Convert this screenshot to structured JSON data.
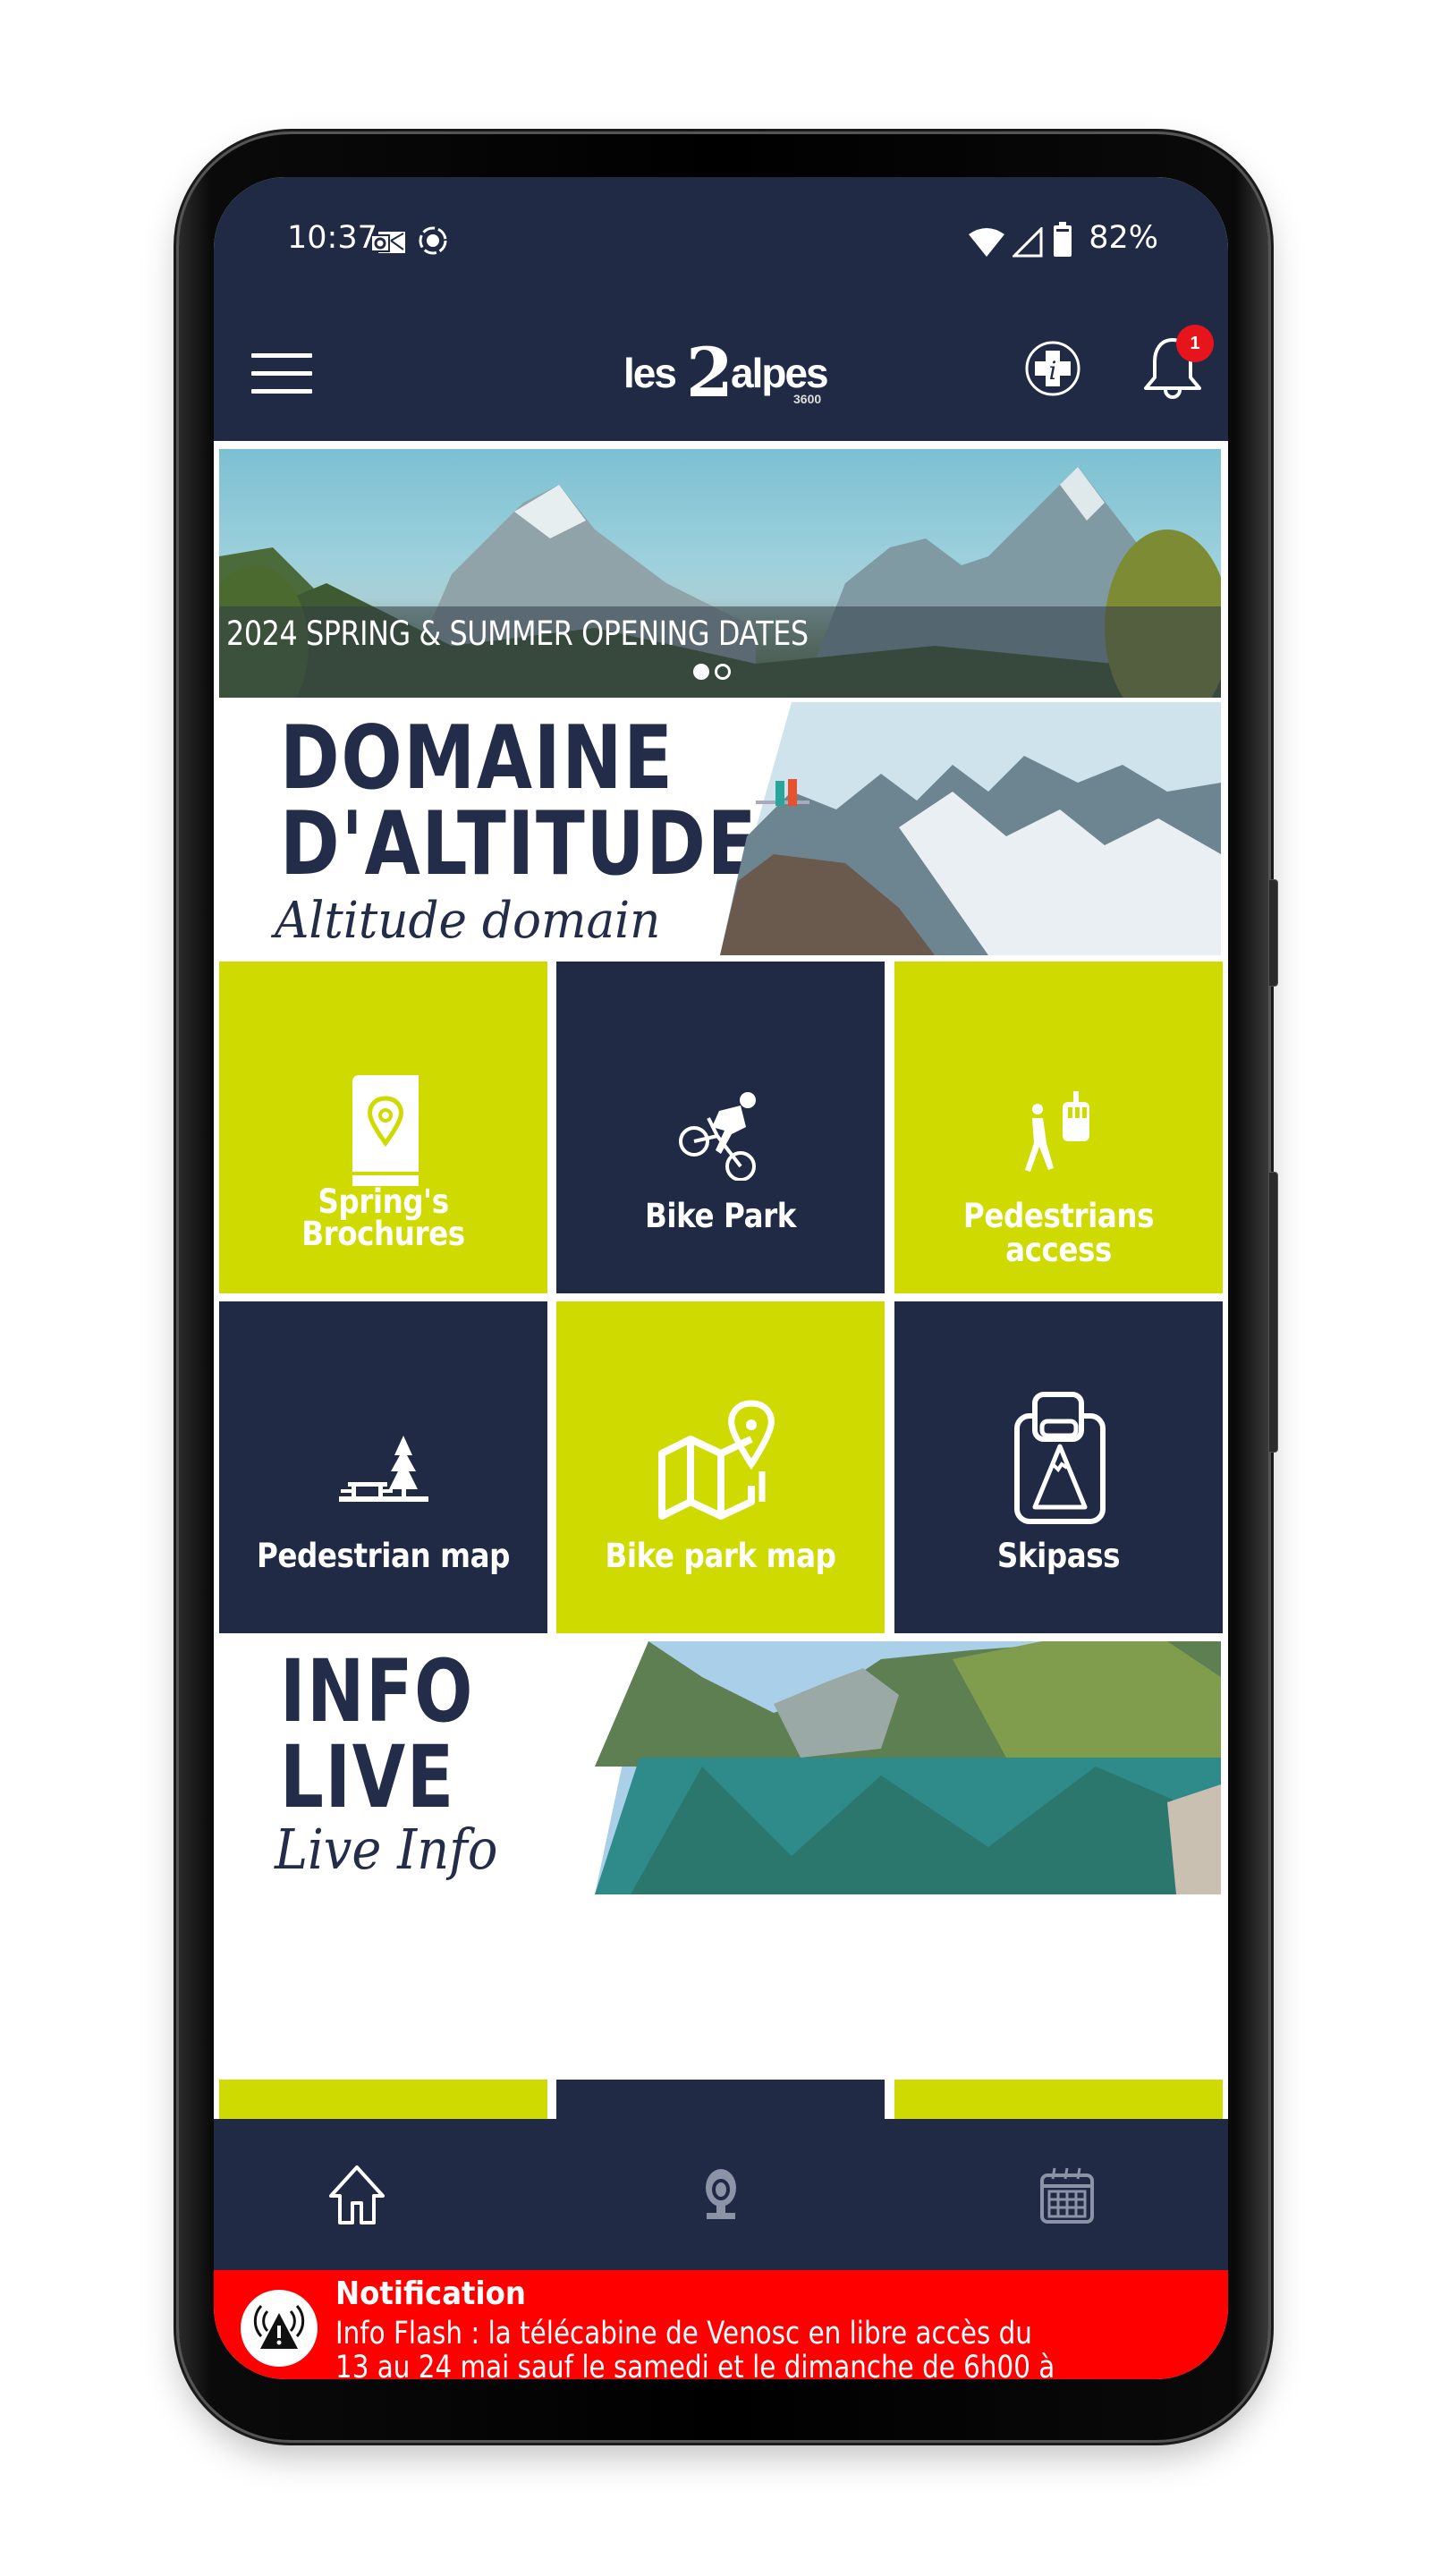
{
  "status_bar": {
    "time": "10:37",
    "battery_percent": "82%",
    "icons": [
      "outlook-icon",
      "screen-record-icon",
      "wifi-icon",
      "cell-signal-icon",
      "battery-icon"
    ]
  },
  "header": {
    "menu_icon": "hamburger-menu-icon",
    "logo": {
      "prefix": "les",
      "numeral": "2",
      "name": "alpes",
      "altitude": "3600"
    },
    "info_icon": "medical-info-icon",
    "bell_icon": "bell-icon",
    "notification_count": "1"
  },
  "hero": {
    "caption": "2024 SPRING & SUMMER OPENING DATES",
    "slide_count": 2,
    "active_slide": 1
  },
  "sections": [
    {
      "title_line1": "DOMAINE",
      "title_line2": "D'ALTITUDE",
      "subtitle": "Altitude domain"
    },
    {
      "title_line1": "INFO",
      "title_line2": "LIVE",
      "subtitle": "Live Info"
    }
  ],
  "tiles": [
    {
      "label": "Spring's Brochures",
      "label_line1": "Spring's",
      "label_line2": "Brochures",
      "icon": "brochure-location-icon",
      "color": "lime"
    },
    {
      "label": "Bike Park",
      "icon": "mountain-biker-icon",
      "color": "navy"
    },
    {
      "label": "Pedestrians access",
      "icon": "pedestrian-gondola-icon",
      "color": "lime"
    },
    {
      "label": "Pedestrian map",
      "icon": "tree-bench-icon",
      "color": "navy"
    },
    {
      "label": "Bike park map",
      "icon": "map-pin-icon",
      "color": "lime"
    },
    {
      "label": "Skipass",
      "icon": "skipass-card-icon",
      "color": "navy"
    },
    {
      "label": "",
      "icon": "webcam-icon",
      "color": "lime"
    },
    {
      "label": "",
      "icon": "weather-sun-cloud-icon",
      "color": "navy"
    },
    {
      "label": "",
      "icon": "cable-car-mountain-icon",
      "color": "lime"
    }
  ],
  "bottom_nav": [
    {
      "name": "home",
      "icon": "home-icon",
      "active": true
    },
    {
      "name": "webcam",
      "icon": "webcam-icon",
      "active": false
    },
    {
      "name": "calendar",
      "icon": "calendar-icon",
      "active": false
    }
  ],
  "notification": {
    "title": "Notification",
    "line1": "Info Flash : la télécabine de Venosc en libre accès du",
    "line2": "13 au 24 mai sauf le samedi et le dimanche de 6h00 à",
    "icon": "alert-broadcast-icon"
  },
  "colors": {
    "navy": "#202a45",
    "lime": "#cfdb00",
    "alert_red": "#fe0000",
    "badge_red": "#e8141c",
    "inactive_nav_icon": "#8c93a6"
  }
}
